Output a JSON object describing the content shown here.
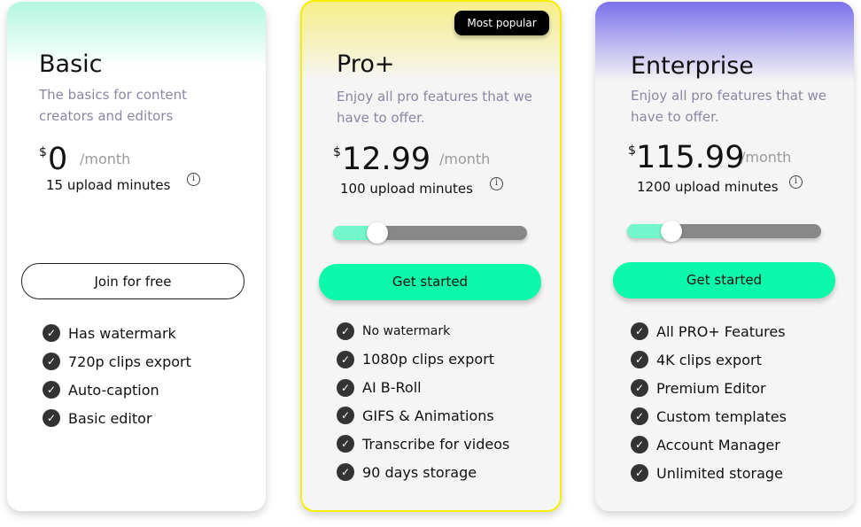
{
  "plans": [
    {
      "name": "Basic",
      "description": "The basics for content creators and editors",
      "currency": "$",
      "price": "0",
      "period": "/month",
      "upload_minutes": "15 upload minutes",
      "button": "Join for free",
      "features": [
        "Has watermark",
        "720p clips export",
        "Auto-caption",
        "Basic editor"
      ],
      "header_color": "#b3f7e0"
    },
    {
      "name": "Pro+",
      "badge": "Most popular",
      "description": "Enjoy all pro features that we have to offer.",
      "currency": "$",
      "price": "12.99",
      "period": "/month",
      "upload_minutes": "100 upload minutes",
      "slider_fraction": 0.23,
      "button": "Get started",
      "features": [
        "No watermark",
        "1080p clips export",
        "AI B-Roll",
        "GIFS & Animations",
        "Transcribe for videos",
        "90 days storage"
      ],
      "header_color": "#f7ee88",
      "border_color": "#f4f000"
    },
    {
      "name": "Enterprise",
      "description": "Enjoy all pro features that we have to offer.",
      "currency": "$",
      "price": "115.99",
      "period": "/month",
      "upload_minutes": "1200 upload minutes",
      "slider_fraction": 0.23,
      "button": "Get started",
      "features": [
        "All PRO+ Features",
        "4K clips export",
        "Premium Editor",
        "Custom templates",
        "Account Manager",
        "Unlimited storage"
      ],
      "header_color": "#7c70ec"
    }
  ],
  "colors": {
    "accent": "#0cf8aa",
    "slider_fill": "#74f6cc",
    "slider_track": "#888888"
  },
  "icons": {
    "info": "info-circle-icon",
    "check": "check-circle-icon"
  }
}
